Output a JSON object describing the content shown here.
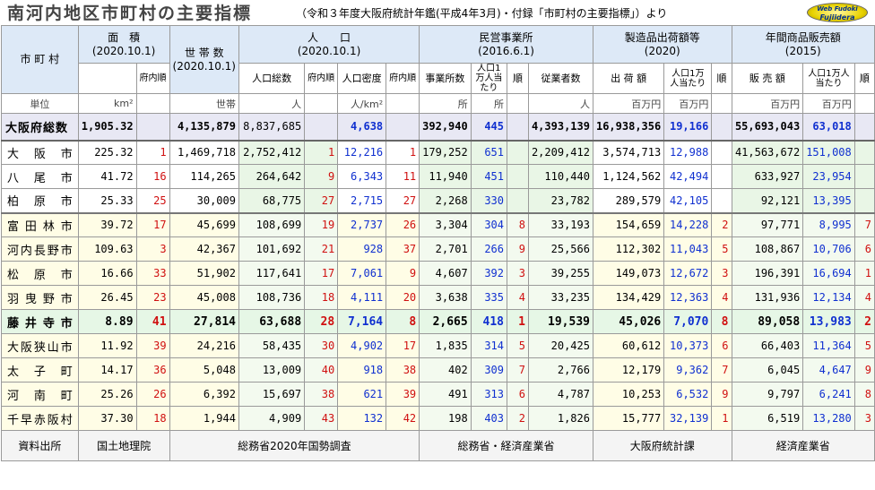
{
  "title": "南河内地区市町村の主要指標",
  "subtitle": "（令和３年度大阪府統計年鑑(平成4年3月)・付録「市町村の主要指標」）より",
  "logo": {
    "line1": "Web Fudoki",
    "line2": "Fujiidera"
  },
  "header": {
    "city": "市 町 村",
    "area": "面　積",
    "area_date": "(2020.10.1)",
    "households": "世 帯 数",
    "households_date": "(2020.10.1)",
    "population": "人　　口",
    "population_date": "(2020.10.1)",
    "business": "民営事業所",
    "business_date": "(2016.6.1)",
    "manufacturing": "製造品出荷額等",
    "manufacturing_date": "(2020)",
    "sales": "年間商品販売額",
    "sales_date": "(2015)"
  },
  "subheader": {
    "area_rank": "府内順",
    "pop_total": "人口総数",
    "pop_rank": "府内順",
    "density": "人口密度",
    "density_rank": "府内順",
    "biz_count": "事業所数",
    "biz_per": "人口1万人当たり",
    "biz_rank": "順",
    "employees": "従業者数",
    "mfg_value": "出 荷 額",
    "mfg_per": "人口1万人当たり",
    "mfg_rank": "順",
    "sales_value": "販 売 額",
    "sales_per": "人口1万人当たり",
    "sales_rank": "順"
  },
  "units": {
    "label": "単位",
    "area": "km²",
    "households": "世帯",
    "population": "人",
    "density": "人/km²",
    "biz": "所",
    "biz_per": "所",
    "employees": "人",
    "mfg": "百万円",
    "mfg_per": "百万円",
    "sales": "百万円",
    "sales_per": "百万円"
  },
  "total": {
    "name": "大阪府総数",
    "area": "1,905.32",
    "households": "4,135,879",
    "population": "8,837,685",
    "density": "4,638",
    "biz": "392,940",
    "biz_per": "445",
    "employees": "4,393,139",
    "mfg": "16,938,356",
    "mfg_per": "19,166",
    "sales": "55,693,043",
    "sales_per": "63,018"
  },
  "rows": [
    {
      "name": "大　阪　市",
      "area": "225.32",
      "area_rank": "1",
      "households": "1,469,718",
      "population": "2,752,412",
      "pop_rank": "1",
      "density": "12,216",
      "density_rank": "1",
      "biz": "179,252",
      "biz_per": "651",
      "biz_rank": "",
      "employees": "2,209,412",
      "mfg": "3,574,713",
      "mfg_per": "12,988",
      "mfg_rank": "",
      "sales": "41,563,672",
      "sales_per": "151,008",
      "sales_rank": ""
    },
    {
      "name": "八　尾　市",
      "area": "41.72",
      "area_rank": "16",
      "households": "114,265",
      "population": "264,642",
      "pop_rank": "9",
      "density": "6,343",
      "density_rank": "11",
      "biz": "11,940",
      "biz_per": "451",
      "biz_rank": "",
      "employees": "110,440",
      "mfg": "1,124,562",
      "mfg_per": "42,494",
      "mfg_rank": "",
      "sales": "633,927",
      "sales_per": "23,954",
      "sales_rank": ""
    },
    {
      "name": "柏　原　市",
      "area": "25.33",
      "area_rank": "25",
      "households": "30,009",
      "population": "68,775",
      "pop_rank": "27",
      "density": "2,715",
      "density_rank": "27",
      "biz": "2,268",
      "biz_per": "330",
      "biz_rank": "",
      "employees": "23,782",
      "mfg": "289,579",
      "mfg_per": "42,105",
      "mfg_rank": "",
      "sales": "92,121",
      "sales_per": "13,395",
      "sales_rank": ""
    },
    {
      "name": "富田林市",
      "area": "39.72",
      "area_rank": "17",
      "households": "45,699",
      "population": "108,699",
      "pop_rank": "19",
      "density": "2,737",
      "density_rank": "26",
      "biz": "3,304",
      "biz_per": "304",
      "biz_rank": "8",
      "employees": "33,193",
      "mfg": "154,659",
      "mfg_per": "14,228",
      "mfg_rank": "2",
      "sales": "97,771",
      "sales_per": "8,995",
      "sales_rank": "7"
    },
    {
      "name": "河内長野市",
      "area": "109.63",
      "area_rank": "3",
      "households": "42,367",
      "population": "101,692",
      "pop_rank": "21",
      "density": "928",
      "density_rank": "37",
      "biz": "2,701",
      "biz_per": "266",
      "biz_rank": "9",
      "employees": "25,566",
      "mfg": "112,302",
      "mfg_per": "11,043",
      "mfg_rank": "5",
      "sales": "108,867",
      "sales_per": "10,706",
      "sales_rank": "6"
    },
    {
      "name": "松　原　市",
      "area": "16.66",
      "area_rank": "33",
      "households": "51,902",
      "population": "117,641",
      "pop_rank": "17",
      "density": "7,061",
      "density_rank": "9",
      "biz": "4,607",
      "biz_per": "392",
      "biz_rank": "3",
      "employees": "39,255",
      "mfg": "149,073",
      "mfg_per": "12,672",
      "mfg_rank": "3",
      "sales": "196,391",
      "sales_per": "16,694",
      "sales_rank": "1"
    },
    {
      "name": "羽曳野市",
      "area": "26.45",
      "area_rank": "23",
      "households": "45,008",
      "population": "108,736",
      "pop_rank": "18",
      "density": "4,111",
      "density_rank": "20",
      "biz": "3,638",
      "biz_per": "335",
      "biz_rank": "4",
      "employees": "33,235",
      "mfg": "134,429",
      "mfg_per": "12,363",
      "mfg_rank": "4",
      "sales": "131,936",
      "sales_per": "12,134",
      "sales_rank": "4"
    },
    {
      "name": "藤井寺市",
      "area": "8.89",
      "area_rank": "41",
      "households": "27,814",
      "population": "63,688",
      "pop_rank": "28",
      "density": "7,164",
      "density_rank": "8",
      "biz": "2,665",
      "biz_per": "418",
      "biz_rank": "1",
      "employees": "19,539",
      "mfg": "45,026",
      "mfg_per": "7,070",
      "mfg_rank": "8",
      "sales": "89,058",
      "sales_per": "13,983",
      "sales_rank": "2"
    },
    {
      "name": "大阪狭山市",
      "area": "11.92",
      "area_rank": "39",
      "households": "24,216",
      "population": "58,435",
      "pop_rank": "30",
      "density": "4,902",
      "density_rank": "17",
      "biz": "1,835",
      "biz_per": "314",
      "biz_rank": "5",
      "employees": "20,425",
      "mfg": "60,612",
      "mfg_per": "10,373",
      "mfg_rank": "6",
      "sales": "66,403",
      "sales_per": "11,364",
      "sales_rank": "5"
    },
    {
      "name": "太　子　町",
      "area": "14.17",
      "area_rank": "36",
      "households": "5,048",
      "population": "13,009",
      "pop_rank": "40",
      "density": "918",
      "density_rank": "38",
      "biz": "402",
      "biz_per": "309",
      "biz_rank": "7",
      "employees": "2,766",
      "mfg": "12,179",
      "mfg_per": "9,362",
      "mfg_rank": "7",
      "sales": "6,045",
      "sales_per": "4,647",
      "sales_rank": "9"
    },
    {
      "name": "河　南　町",
      "area": "25.26",
      "area_rank": "26",
      "households": "6,392",
      "population": "15,697",
      "pop_rank": "38",
      "density": "621",
      "density_rank": "39",
      "biz": "491",
      "biz_per": "313",
      "biz_rank": "6",
      "employees": "4,787",
      "mfg": "10,253",
      "mfg_per": "6,532",
      "mfg_rank": "9",
      "sales": "9,797",
      "sales_per": "6,241",
      "sales_rank": "8"
    },
    {
      "name": "千早赤阪村",
      "area": "37.30",
      "area_rank": "18",
      "households": "1,944",
      "population": "4,909",
      "pop_rank": "43",
      "density": "132",
      "density_rank": "42",
      "biz": "198",
      "biz_per": "403",
      "biz_rank": "2",
      "employees": "1,826",
      "mfg": "15,777",
      "mfg_per": "32,139",
      "mfg_rank": "1",
      "sales": "6,519",
      "sales_per": "13,280",
      "sales_rank": "3"
    }
  ],
  "sources": {
    "label": "資料出所",
    "area": "国土地理院",
    "census": "総務省2020年国勢調査",
    "business": "総務省・経済産業省",
    "manufacturing": "大阪府統計課",
    "sales": "経済産業省"
  }
}
